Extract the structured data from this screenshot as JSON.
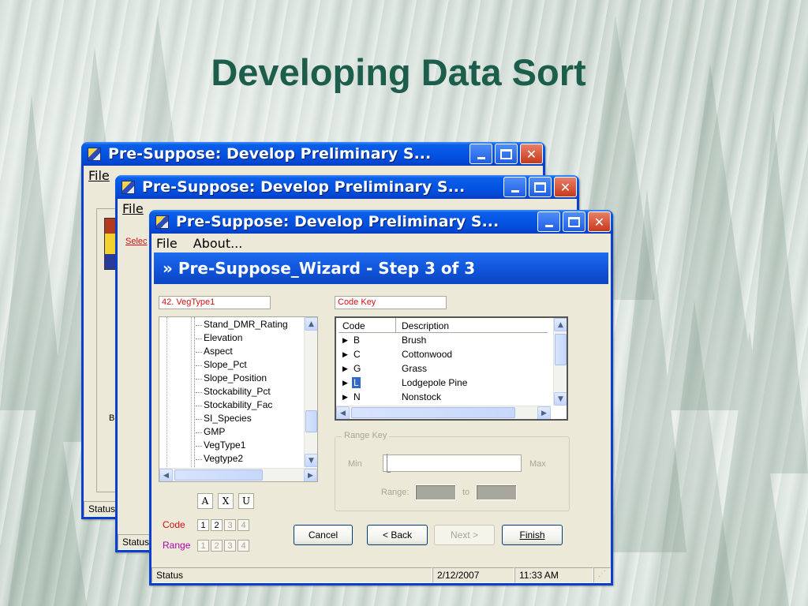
{
  "slide": {
    "title": "Developing Data Sort"
  },
  "back_window_1": {
    "title": "Pre-Suppose: Develop Preliminary S...",
    "menu": [
      "File"
    ],
    "status": "Status",
    "partial_text": "Bl"
  },
  "back_window_2": {
    "title": "Pre-Suppose: Develop Preliminary S...",
    "menu": [
      "File"
    ],
    "partial_link": "Selec",
    "status": "Status"
  },
  "window": {
    "title": "Pre-Suppose: Develop Preliminary S...",
    "menu": [
      "File",
      "About..."
    ],
    "wizard_title": "» Pre-Suppose_Wizard - Step 3 of 3",
    "field_left": "42. VegType1",
    "field_right": "Code Key",
    "tree_items": [
      "Stand_DMR_Rating",
      "Elevation",
      "Aspect",
      "Slope_Pct",
      "Slope_Position",
      "Stockability_Pct",
      "Stockability_Fac",
      "SI_Species",
      "GMP",
      "VegType1",
      "Vegtype2"
    ],
    "grid": {
      "headers": [
        "Code",
        "Description"
      ],
      "rows": [
        {
          "code": "B",
          "description": "Brush"
        },
        {
          "code": "C",
          "description": "Cottonwood"
        },
        {
          "code": "G",
          "description": "Grass"
        },
        {
          "code": "L",
          "description": "Lodgepole Pine",
          "selected": true
        },
        {
          "code": "N",
          "description": "Nonstock"
        }
      ]
    },
    "range_key": {
      "title": "Range Key",
      "min_label": "Min",
      "max_label": "Max",
      "range_label": "Range:",
      "to_label": "to"
    },
    "sort_buttons": [
      "A",
      "X",
      "U"
    ],
    "code_label": "Code",
    "range_label": "Range",
    "code_numbers": [
      "1",
      "2",
      "3",
      "4"
    ],
    "range_numbers": [
      "1",
      "2",
      "3",
      "4"
    ],
    "buttons": {
      "cancel": "Cancel",
      "back": "< Back",
      "next": "Next >",
      "finish": "Finish"
    },
    "status": {
      "text": "Status",
      "date": "2/12/2007",
      "time": "11:33 AM"
    }
  },
  "colors": {
    "title_green": "#1d5d4c",
    "xp_blue": "#0454e3",
    "field_red": "#d01010",
    "range_purple": "#b000b0"
  }
}
